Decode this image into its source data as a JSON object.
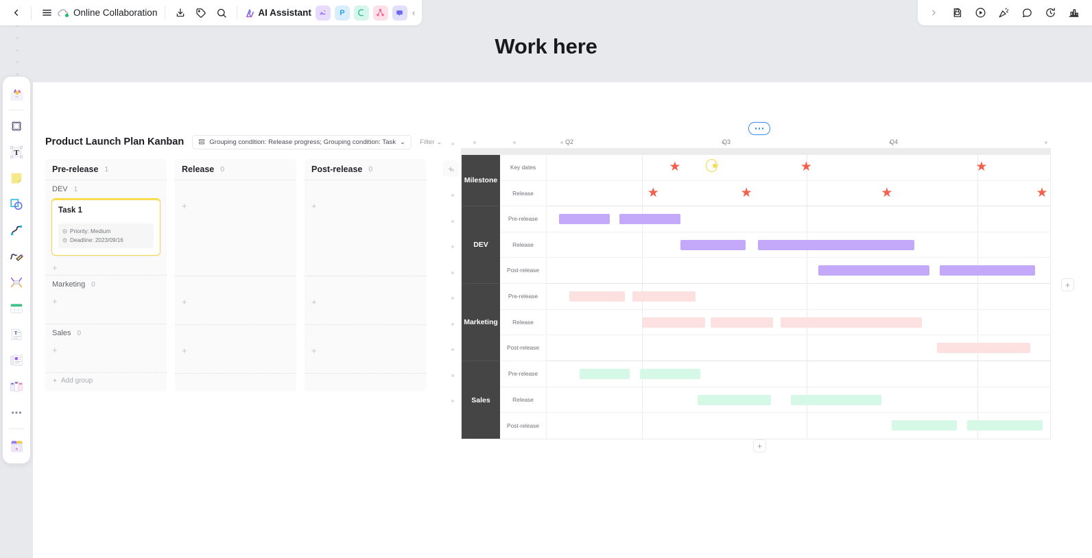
{
  "canvas": {
    "heading": "Work here"
  },
  "toolbar": {
    "back_label": "‹",
    "menu_label": "menu",
    "doc_title": "Online Collaboration",
    "download_label": "download",
    "tag_label": "tag",
    "search_label": "search",
    "ai_assistant": "AI Assistant",
    "apps": [
      {
        "name": "image-app",
        "glyph": "✦",
        "bg": "#e7dcfb",
        "fg": "#8a5cf0"
      },
      {
        "name": "ppt-app",
        "glyph": "P",
        "bg": "#d8eefd",
        "fg": "#2f9fe6"
      },
      {
        "name": "mind-app",
        "glyph": "❦",
        "bg": "#d6f6ec",
        "fg": "#1fba8c"
      },
      {
        "name": "chart-app",
        "glyph": "∴",
        "bg": "#fde0e8",
        "fg": "#f1698f"
      },
      {
        "name": "chat-app",
        "glyph": "▭",
        "bg": "#e0e0fb",
        "fg": "#6a6af0"
      }
    ],
    "collapse_label": "‹"
  },
  "toolbar_right": {
    "expand_label": "›",
    "icons": [
      {
        "name": "lock-note-icon"
      },
      {
        "name": "play-circle-icon"
      },
      {
        "name": "celebrate-icon"
      },
      {
        "name": "comment-icon"
      },
      {
        "name": "history-icon"
      },
      {
        "name": "chart-bar-icon"
      }
    ]
  },
  "left_rail": {
    "items": [
      {
        "name": "assets-icon"
      },
      {
        "name": "frame-icon"
      },
      {
        "name": "text-icon"
      },
      {
        "name": "sticky-note-icon"
      },
      {
        "name": "shapes-icon"
      },
      {
        "name": "curve-line-icon"
      },
      {
        "name": "pen-icon"
      },
      {
        "name": "connector-icon"
      },
      {
        "name": "table-icon"
      },
      {
        "name": "doc-icon"
      },
      {
        "name": "card-icon"
      },
      {
        "name": "kanban-icon"
      },
      {
        "name": "more-icon"
      },
      {
        "name": "template-icon"
      }
    ]
  },
  "kanban": {
    "title": "Product Launch Plan Kanban",
    "grouping_pill": "Grouping condition: Release progress; Grouping condition: Task",
    "grouping_caret": "⌄",
    "filter_label": "Filter",
    "filter_caret": "⌄",
    "add_column_label": "+",
    "add_group_label": "Add group",
    "add_card_label": "+",
    "columns": [
      {
        "name": "Pre-release",
        "count": "1",
        "groups": [
          {
            "name": "DEV",
            "count": "1",
            "cards": [
              {
                "title": "Task 1",
                "meta": [
                  {
                    "icon": "flag-icon",
                    "text": "Priority: Medium"
                  },
                  {
                    "icon": "clock-icon",
                    "text": "Deadline: 2023/09/16"
                  }
                ]
              }
            ]
          },
          {
            "name": "Marketing",
            "count": "0",
            "cards": []
          },
          {
            "name": "Sales",
            "count": "0",
            "cards": []
          }
        ]
      },
      {
        "name": "Release",
        "count": "0",
        "groups": [
          {
            "name": "",
            "count": "",
            "cards": []
          },
          {
            "name": "",
            "count": "",
            "cards": []
          },
          {
            "name": "",
            "count": "",
            "cards": []
          }
        ]
      },
      {
        "name": "Post-release",
        "count": "0",
        "groups": [
          {
            "name": "",
            "count": "",
            "cards": []
          },
          {
            "name": "",
            "count": "",
            "cards": []
          },
          {
            "name": "",
            "count": "",
            "cards": []
          }
        ]
      }
    ]
  },
  "gantt": {
    "more_label": "more-options",
    "add_row_right_label": "+",
    "add_row_bottom_label": "+",
    "axis_labels": [
      "Q2",
      "Q3",
      "Q4"
    ],
    "categories": [
      {
        "name": "Milestone",
        "rows": [
          {
            "label": "Key dates"
          },
          {
            "label": "Release"
          }
        ]
      },
      {
        "name": "DEV",
        "rows": [
          {
            "label": "Pre-release"
          },
          {
            "label": "Release"
          },
          {
            "label": "Post-release"
          }
        ]
      },
      {
        "name": "Marketing",
        "rows": [
          {
            "label": "Pre-release"
          },
          {
            "label": "Release"
          },
          {
            "label": "Post-release"
          }
        ]
      },
      {
        "name": "Sales",
        "rows": [
          {
            "label": "Pre-release"
          },
          {
            "label": "Release"
          },
          {
            "label": "Post-release"
          }
        ]
      }
    ]
  },
  "chart_data": {
    "type": "bar",
    "title": "Product Launch Plan Gantt",
    "xlabel": "",
    "ylabel": "",
    "axis_ticks": [
      "Q2",
      "Q3",
      "Q4"
    ],
    "axis_tick_positions_pct": [
      19.0,
      51.6,
      85.5
    ],
    "colors": {
      "milestone_star": "#f3604e",
      "highlight_ring": "#f2d83c",
      "dev_bar": "#c4a8fa",
      "marketing_bar": "#fde0e0",
      "sales_bar": "#d6f8e6",
      "category_header": "#454546"
    },
    "rows": [
      {
        "category": "Milestone",
        "row": "Key dates",
        "kind": "markers",
        "markers": [
          {
            "pos_pct": 26.0,
            "highlighted": false
          },
          {
            "pos_pct": 34.0,
            "highlighted": true
          },
          {
            "pos_pct": 52.0,
            "highlighted": false
          },
          {
            "pos_pct": 87.0,
            "highlighted": false
          }
        ]
      },
      {
        "category": "Milestone",
        "row": "Release",
        "kind": "markers",
        "markers": [
          {
            "pos_pct": 21.5,
            "highlighted": false
          },
          {
            "pos_pct": 40.0,
            "highlighted": false
          },
          {
            "pos_pct": 68.0,
            "highlighted": false
          },
          {
            "pos_pct": 99.0,
            "highlighted": false
          }
        ]
      },
      {
        "category": "DEV",
        "row": "Pre-release",
        "kind": "bars",
        "color": "#c4a8fa",
        "bars": [
          {
            "start_pct": 2.5,
            "end_pct": 12.5
          },
          {
            "start_pct": 14.5,
            "end_pct": 26.5
          }
        ]
      },
      {
        "category": "DEV",
        "row": "Release",
        "kind": "bars",
        "color": "#c4a8fa",
        "bars": [
          {
            "start_pct": 26.5,
            "end_pct": 39.5
          },
          {
            "start_pct": 42.0,
            "end_pct": 73.0
          }
        ]
      },
      {
        "category": "DEV",
        "row": "Post-release",
        "kind": "bars",
        "color": "#c4a8fa",
        "bars": [
          {
            "start_pct": 54.0,
            "end_pct": 76.0
          },
          {
            "start_pct": 78.0,
            "end_pct": 97.0
          }
        ]
      },
      {
        "category": "Marketing",
        "row": "Pre-release",
        "kind": "bars",
        "color": "#fde0e0",
        "bars": [
          {
            "start_pct": 4.5,
            "end_pct": 15.5
          },
          {
            "start_pct": 17.0,
            "end_pct": 29.5
          }
        ]
      },
      {
        "category": "Marketing",
        "row": "Release",
        "kind": "bars",
        "color": "#fde0e0",
        "bars": [
          {
            "start_pct": 19.0,
            "end_pct": 31.5
          },
          {
            "start_pct": 32.5,
            "end_pct": 45.0
          },
          {
            "start_pct": 46.5,
            "end_pct": 74.5
          }
        ]
      },
      {
        "category": "Marketing",
        "row": "Post-release",
        "kind": "bars",
        "color": "#fde0e0",
        "bars": [
          {
            "start_pct": 77.5,
            "end_pct": 96.0
          }
        ]
      },
      {
        "category": "Sales",
        "row": "Pre-release",
        "kind": "bars",
        "color": "#d6f8e6",
        "bars": [
          {
            "start_pct": 6.5,
            "end_pct": 16.5
          },
          {
            "start_pct": 18.5,
            "end_pct": 30.5
          }
        ]
      },
      {
        "category": "Sales",
        "row": "Release",
        "kind": "bars",
        "color": "#d6f8e6",
        "bars": [
          {
            "start_pct": 30.0,
            "end_pct": 44.5
          },
          {
            "start_pct": 48.5,
            "end_pct": 66.5
          }
        ]
      },
      {
        "category": "Sales",
        "row": "Post-release",
        "kind": "bars",
        "color": "#d6f8e6",
        "bars": [
          {
            "start_pct": 68.5,
            "end_pct": 81.5
          },
          {
            "start_pct": 83.5,
            "end_pct": 98.5
          }
        ]
      }
    ]
  }
}
